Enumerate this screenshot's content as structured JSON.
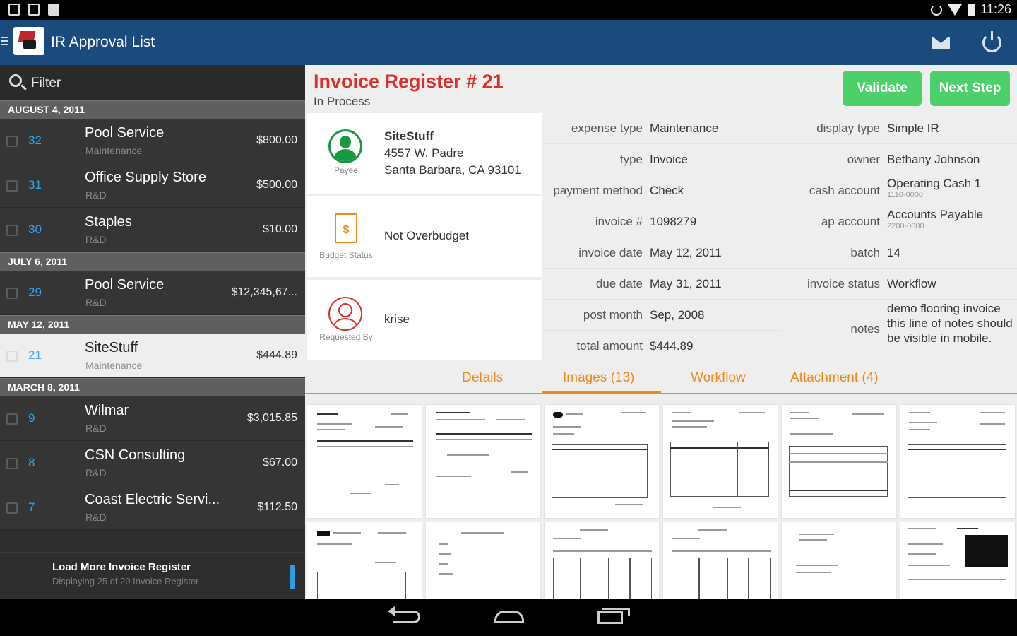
{
  "status_bar": {
    "time": "11:26"
  },
  "app": {
    "title": "IR Approval List"
  },
  "filter": {
    "label": "Filter"
  },
  "list": {
    "groups": [
      {
        "header": "AUGUST 4, 2011",
        "rows": [
          {
            "num": "32",
            "name": "Pool Service",
            "sub": "Maintenance",
            "amount": "$800.00"
          },
          {
            "num": "31",
            "name": "Office Supply Store",
            "sub": "R&D",
            "amount": "$500.00"
          },
          {
            "num": "30",
            "name": "Staples",
            "sub": "R&D",
            "amount": "$10.00"
          }
        ]
      },
      {
        "header": "JULY 6, 2011",
        "rows": [
          {
            "num": "29",
            "name": "Pool Service",
            "sub": "R&D",
            "amount": "$12,345,67..."
          }
        ]
      },
      {
        "header": "MAY 12, 2011",
        "rows": [
          {
            "num": "21",
            "name": "SiteStuff",
            "sub": "Maintenance",
            "amount": "$444.89"
          }
        ]
      },
      {
        "header": "MARCH 8, 2011",
        "rows": [
          {
            "num": "9",
            "name": "Wilmar",
            "sub": "R&D",
            "amount": "$3,015.85"
          },
          {
            "num": "8",
            "name": "CSN Consulting",
            "sub": "R&D",
            "amount": "$67.00"
          },
          {
            "num": "7",
            "name": "Coast Electric Servi...",
            "sub": "R&D",
            "amount": "$112.50"
          }
        ]
      }
    ],
    "load_more": {
      "title": "Load More Invoice Register",
      "subtitle": "Displaying 25 of 29 Invoice Register"
    }
  },
  "invoice": {
    "title": "Invoice Register # 21",
    "status": "In Process",
    "buttons": {
      "validate": "Validate",
      "next_step": "Next Step"
    },
    "payee": {
      "caption": "Payee",
      "name": "SiteStuff",
      "address1": "4557 W. Padre",
      "address2": "Santa Barbara, CA 93101"
    },
    "budget": {
      "caption": "Budget Status",
      "value": "Not Overbudget"
    },
    "requested": {
      "caption": "Requested By",
      "value": "krise"
    },
    "fields_left": [
      {
        "label": "expense type",
        "value": "Maintenance"
      },
      {
        "label": "type",
        "value": "Invoice"
      },
      {
        "label": "payment method",
        "value": "Check"
      },
      {
        "label": "invoice #",
        "value": "1098279"
      },
      {
        "label": "invoice date",
        "value": "May 12, 2011"
      },
      {
        "label": "due date",
        "value": "May 31, 2011"
      },
      {
        "label": "post month",
        "value": "Sep, 2008"
      },
      {
        "label": "total amount",
        "value": "$444.89"
      }
    ],
    "fields_right": [
      {
        "label": "display type",
        "value": "Simple IR"
      },
      {
        "label": "owner",
        "value": "Bethany Johnson"
      },
      {
        "label": "cash account",
        "value": "Operating Cash 1",
        "sub": "1110-0000"
      },
      {
        "label": "ap account",
        "value": "Accounts Payable",
        "sub": "2200-0000"
      },
      {
        "label": "batch",
        "value": "14"
      },
      {
        "label": "invoice status",
        "value": "Workflow"
      },
      {
        "label": "notes",
        "value": "demo flooring invoice this line of notes should be visible in mobile."
      }
    ],
    "tabs": [
      "Details",
      "Images (13)",
      "Workflow",
      "Attachment (4)"
    ],
    "selected_tab": "Images (13)"
  },
  "colors": {
    "action_bar": "#1b4a7c",
    "accent_orange": "#f08a1c",
    "green_button": "#4cd06a",
    "title_red": "#d9312b",
    "link_blue": "#35a5e6"
  }
}
